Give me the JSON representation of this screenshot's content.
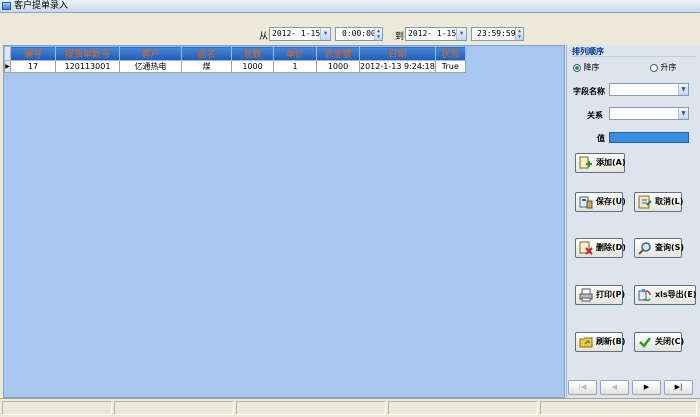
{
  "window": {
    "title": "客户提单录入"
  },
  "filter": {
    "from_label": "从",
    "from_date": "2012- 1-15",
    "from_time": "0:00:00",
    "to_label": "到",
    "to_date": "2012- 1-15",
    "to_time": "23:59:59"
  },
  "grid": {
    "columns": [
      "编号",
      "提货单数号",
      "客户",
      "品名",
      "总数",
      "单价",
      "总金额",
      "日期",
      "状态"
    ],
    "rows": [
      [
        "17",
        "120113001",
        "亿通热电",
        "煤",
        "1000",
        "1",
        "1000",
        "2012-1-13 9:24:18",
        "True"
      ]
    ],
    "current_row_marker": "▶"
  },
  "sort": {
    "title": "排列顺序",
    "desc_label": "降序",
    "asc_label": "升序",
    "selected": "desc"
  },
  "query": {
    "field_label": "字段名称",
    "relation_label": "关系",
    "value_label": "值"
  },
  "buttons": {
    "add": "添加(A)",
    "save": "保存(U)",
    "cancel": "取消(L)",
    "delete": "删除(D)",
    "search": "查询(S)",
    "print": "打印(P)",
    "export": "xls导出(E)",
    "refresh": "刷新(B)",
    "close": "关闭(C)"
  },
  "nav": {
    "first": "|◀",
    "prev": "◀",
    "next": "▶",
    "last": "▶|"
  },
  "colors": {
    "grid_background": "#a6c8f0",
    "header_background": "#2a6ac4",
    "header_text": "#e06a1a",
    "panel_title": "#003399"
  }
}
